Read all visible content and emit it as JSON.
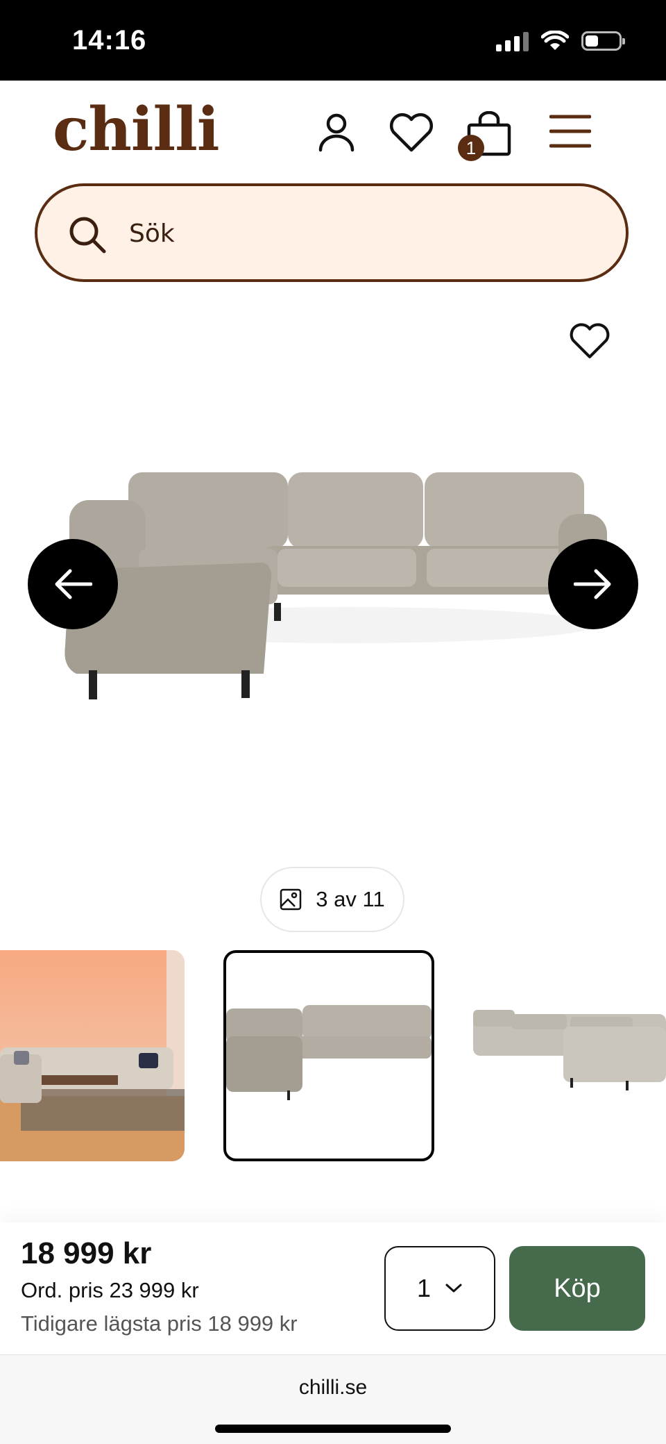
{
  "status_bar": {
    "time": "14:16"
  },
  "header": {
    "logo": "chilli",
    "cart_count": "1"
  },
  "search": {
    "placeholder": "Sök"
  },
  "gallery": {
    "counter": "3 av 11"
  },
  "buy_bar": {
    "price": "18 999 kr",
    "ordinary_price": "Ord. pris 23 999 kr",
    "lowest_price": "Tidigare lägsta pris 18 999 kr",
    "quantity": "1",
    "buy_label": "Köp"
  },
  "browser": {
    "url": "chilli.se"
  },
  "colors": {
    "brand": "#5a2d12",
    "search_bg": "#fff1e6",
    "buy_button": "#456b4c"
  },
  "icons": [
    "user-icon",
    "heart-icon",
    "bag-icon",
    "menu-icon",
    "search-icon",
    "arrow-left-icon",
    "arrow-right-icon",
    "image-icon",
    "chevron-down-icon"
  ]
}
